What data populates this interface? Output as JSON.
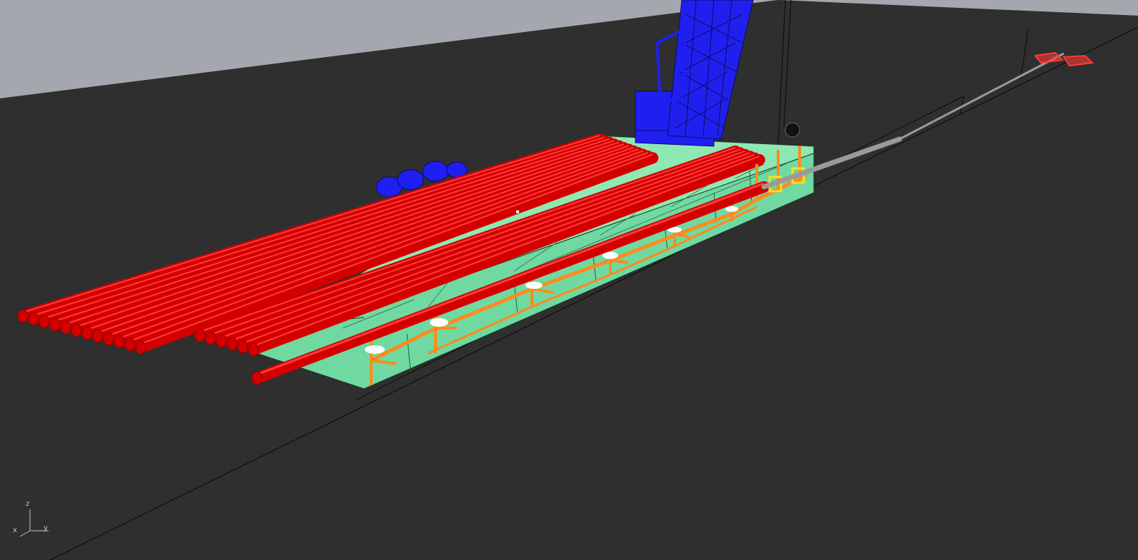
{
  "viewport": {
    "name": "Perspective",
    "background_color": "#2f2f2f",
    "sky_color": "#a4a7ad"
  },
  "scene": {
    "barge": {
      "deck_color": "#8ee8b4",
      "side_color": "#6fd9a1",
      "edge_color": "#1a3a2a"
    },
    "pipes": {
      "color": "#d40000",
      "highlight_color": "#ff3a3a",
      "stack_count": 18,
      "row_count": 2
    },
    "single_pipe": {
      "color": "#d40000"
    },
    "stinger": {
      "color": "#ff8a1c",
      "roller_color": "#ffffff"
    },
    "crane": {
      "color": "#1f1ff2"
    },
    "winches": {
      "color": "#1f1ff2"
    },
    "tensioner": {
      "color": "#ffe01a"
    },
    "pipeline": {
      "color": "#9a9a9a"
    },
    "anchor": {
      "color": "#ff3a3a"
    }
  },
  "axis_widget": {
    "z_label": "z",
    "x_label": "x",
    "y_label": "y",
    "line_color": "#c8c8c8"
  }
}
